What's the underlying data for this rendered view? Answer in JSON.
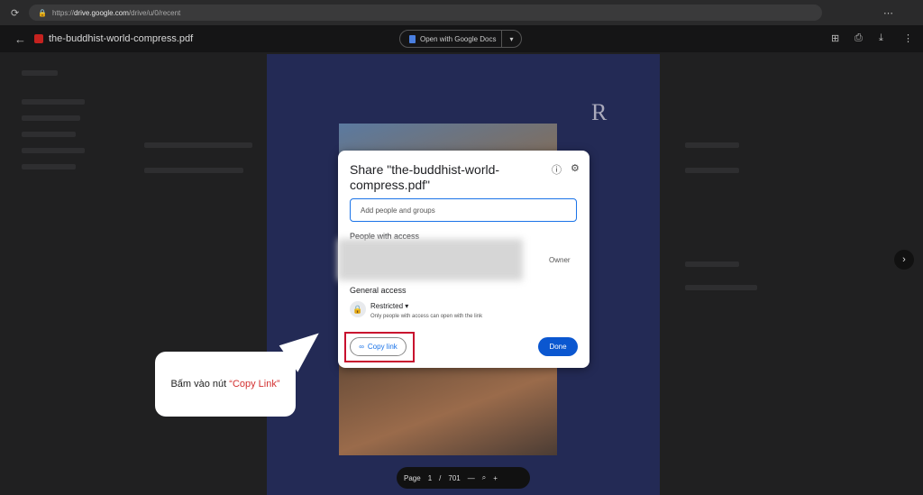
{
  "browser": {
    "url_prefix": "https://",
    "url_domain": "drive.google.com",
    "url_path": "/drive/u/0/recent"
  },
  "viewer": {
    "file_name": "the-buddhist-world-compress.pdf",
    "open_with": "Open with Google Docs"
  },
  "share": {
    "title": "Share \"the-buddhist-world-compress.pdf\"",
    "placeholder": "Add people and groups",
    "people_label": "People with access",
    "owner": "Owner",
    "general_label": "General access",
    "access_level": "Restricted",
    "access_desc": "Only people with access can open with the link",
    "copy_link": "Copy link",
    "done": "Done"
  },
  "callout": {
    "prefix": "Bấm vào nút ",
    "highlight": "“Copy Link”"
  },
  "pager": {
    "label": "Page",
    "current": "1",
    "sep": "/",
    "total": "701"
  },
  "colors": {
    "accent": "#1a73e8",
    "done": "#0b57d0",
    "highlight": "#c8102e"
  }
}
